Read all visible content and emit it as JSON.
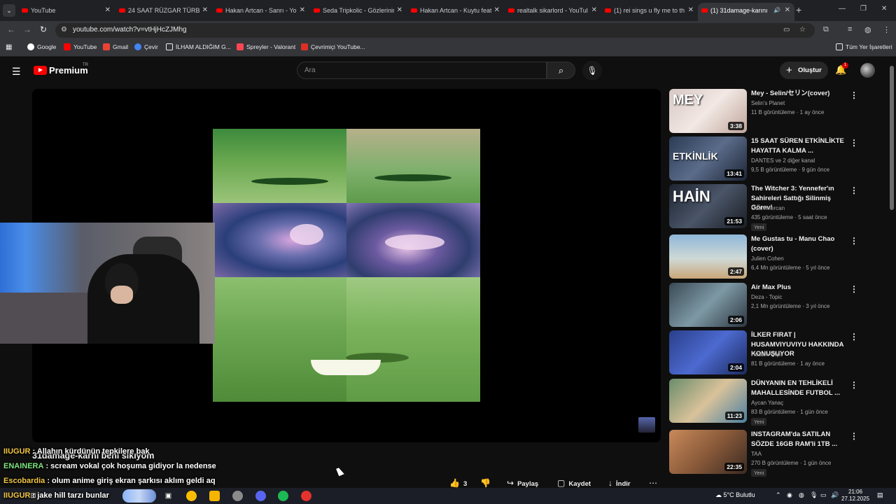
{
  "browser": {
    "tabs": [
      {
        "title": "YouTube",
        "active": false
      },
      {
        "title": "24 SAAT RÜZGAR TÜRBİN",
        "active": false
      },
      {
        "title": "Hakan Artcan - Sanrı - Yo",
        "active": false
      },
      {
        "title": "Seda Tripkolic - Gözlerinin",
        "active": false
      },
      {
        "title": "Hakan Artcan - Kuytu feat",
        "active": false
      },
      {
        "title": "realtalk sikarlord - YouTul",
        "active": false
      },
      {
        "title": "(1) rei sings u fly me to th",
        "active": false
      },
      {
        "title": "(1) 31damage-karını",
        "active": true
      }
    ],
    "url": "youtube.com/watch?v=vtHjHcZJMhg",
    "bookmarks": [
      "Google",
      "YouTube",
      "Gmail",
      "Çevir",
      "İLHAM ALDIĞIM G...",
      "Spreyler - Valorant",
      "Çevrimiçi YouTube..."
    ],
    "all_bookmarks": "Tüm Yer İşaretleri"
  },
  "youtube": {
    "brand": "Premium",
    "region": "TR",
    "search_placeholder": "Ara",
    "create_label": "Oluştur",
    "notification_count": "1"
  },
  "overlay": {
    "title": "31damage-karnı beni sıkıyom",
    "chat": [
      {
        "user": "IIUGUR",
        "text": ": Allahın kürdünün tepkilere bak"
      },
      {
        "user": "ENAINERA",
        "text": ": scream vokal çok hoşuma gidiyor la nedense"
      },
      {
        "user": "Escobardia",
        "text": ": olum anime giriş ekran şarkısı aklım geldi aq"
      },
      {
        "user": "IIUGUR",
        "text": ": jake hill tarzı bunlar"
      }
    ]
  },
  "actions": {
    "likes": "3",
    "share": "Paylaş",
    "save": "Kaydet",
    "download": "İndir"
  },
  "recommendations": [
    {
      "title": "Mey - Selin/セリン(cover)",
      "channel": "Selin's Planet",
      "meta": "11 B görüntüleme · 1 ay önce",
      "duration": "3:38",
      "thumb_text": "MEY",
      "badge": ""
    },
    {
      "title": "15 SAAT SÜREN ETKİNLİKTE HAYATTA KALMA ...",
      "channel": "DANTES ve 2 diğer kanal",
      "meta": "9,5 B görüntüleme · 9 gün önce",
      "duration": "13:41",
      "thumb_text": "ETKİNLİK",
      "badge": ""
    },
    {
      "title": "The Witcher 3: Yennefer'ın Sahireleri Sattığı Silinmiş Görev!",
      "channel": "Ozan Mercan",
      "meta": "435 görüntüleme · 5 saat önce",
      "duration": "21:53",
      "thumb_text": "HAİN",
      "badge": "Yeni"
    },
    {
      "title": "Me Gustas tu - Manu Chao (cover)",
      "channel": "Julien Cohen",
      "meta": "6,4 Mn görüntüleme · 5 yıl önce",
      "duration": "2:47",
      "thumb_text": "",
      "badge": ""
    },
    {
      "title": "Air Max Plus",
      "channel": "Deza - Topic",
      "meta": "2,1 Mn görüntüleme · 3 yıl önce",
      "duration": "2:06",
      "thumb_text": "",
      "badge": ""
    },
    {
      "title": "İLKER FIRAT | HUSAMVIYUVIYU HAKKINDA KONUŞUYOR",
      "channel": "Husam Clips",
      "meta": "81 B görüntüleme · 1 ay önce",
      "duration": "2:04",
      "thumb_text": "",
      "badge": ""
    },
    {
      "title": "DÜNYANIN EN TEHLİKELİ MAHALLESİNDE FUTBOL ...",
      "channel": "Aycan Yanaç",
      "meta": "83 B görüntüleme · 1 gün önce",
      "duration": "11:23",
      "thumb_text": "",
      "badge": "Yeni"
    },
    {
      "title": "INSTAGRAM'da SATILAN SÖZDE 16GB RAM'li 1TB ...",
      "channel": "TAA",
      "meta": "270 B görüntüleme · 1 gün önce",
      "duration": "22:35",
      "thumb_text": "",
      "badge": "Yeni"
    }
  ],
  "taskbar": {
    "weather": "5°C  Bulutlu",
    "time": "21:06",
    "date": "27.12.2025"
  }
}
